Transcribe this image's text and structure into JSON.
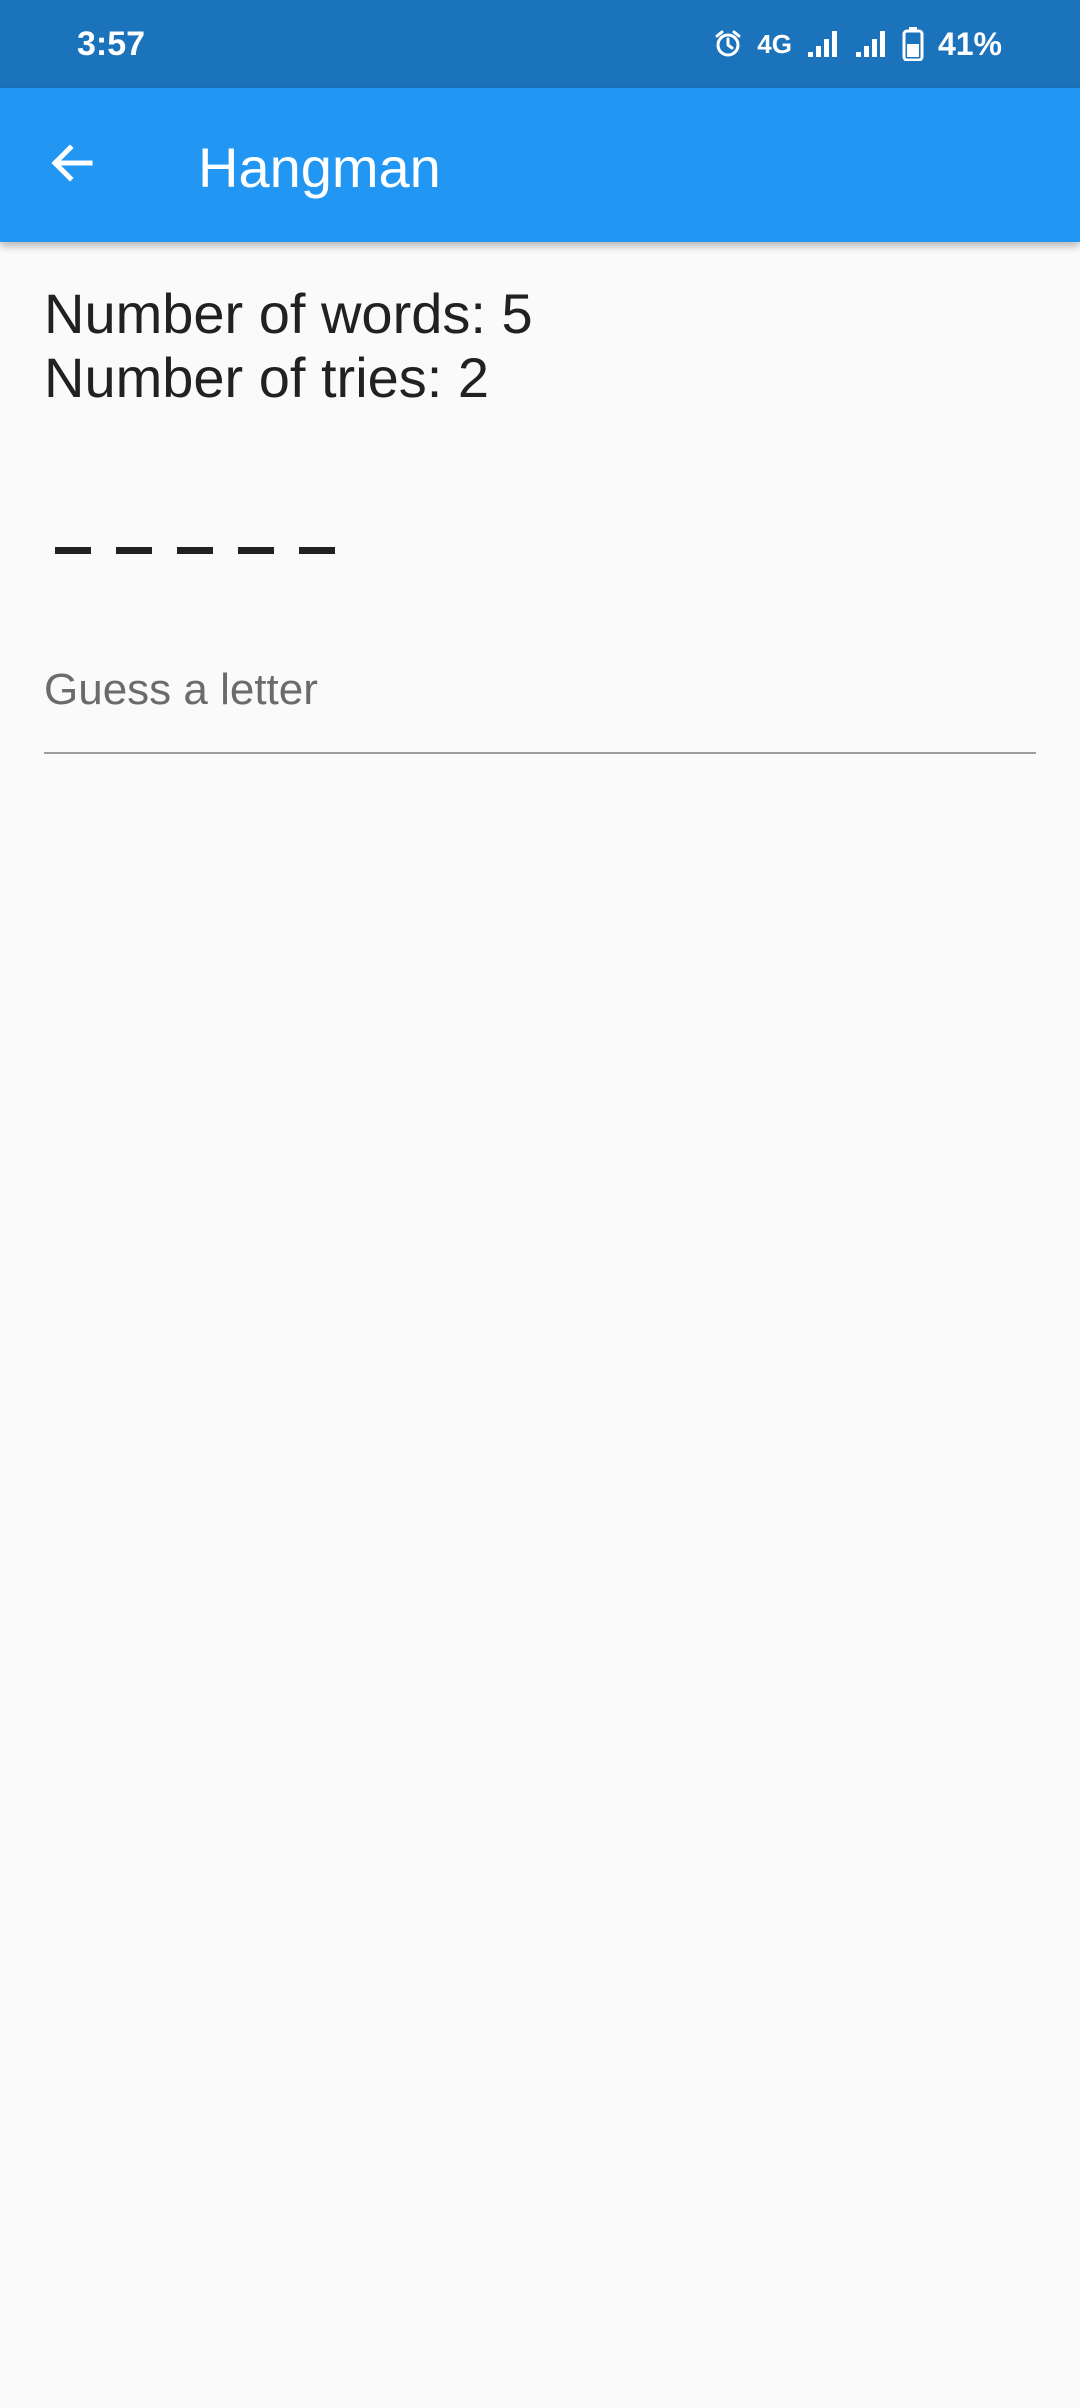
{
  "status_bar": {
    "time": "3:57",
    "network": "4G",
    "battery_percent": "41%",
    "icons": [
      "alarm-icon",
      "signal-icon",
      "signal-icon",
      "battery-icon"
    ]
  },
  "app_bar": {
    "title": "Hangman",
    "back_icon": "arrow-back-icon",
    "color": "#2196f3"
  },
  "game": {
    "words_line": "Number of words: 5",
    "tries_line": "Number of tries: 2",
    "letter_slots": 5
  },
  "guess_input": {
    "placeholder": "Guess a letter",
    "value": ""
  },
  "colors": {
    "status_bar": "#1b73bb",
    "app_bar": "#2196f3",
    "background": "#fafafa",
    "text": "#212121"
  }
}
